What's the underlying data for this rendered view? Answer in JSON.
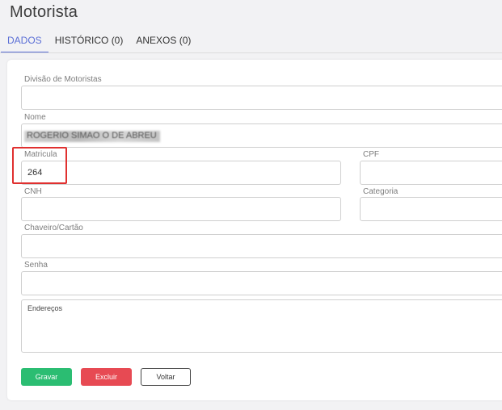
{
  "page": {
    "title": "Motorista"
  },
  "tabs": [
    {
      "label": "DADOS",
      "active": true
    },
    {
      "label": "HISTÓRICO (0)",
      "active": false
    },
    {
      "label": "ANEXOS (0)",
      "active": false
    }
  ],
  "form": {
    "divisao": {
      "label": "Divisão de Motoristas",
      "value": ""
    },
    "nome": {
      "label": "Nome",
      "value": "ROGERIO SIMAO O DE ABREU"
    },
    "matricula": {
      "label": "Matricula",
      "value": "264"
    },
    "cpf": {
      "label": "CPF",
      "value": ""
    },
    "cnh": {
      "label": "CNH",
      "value": ""
    },
    "categoria": {
      "label": "Categoria",
      "value": ""
    },
    "chaveiro": {
      "label": "Chaveiro/Cartão",
      "value": ""
    },
    "senha": {
      "label": "Senha",
      "value": ""
    },
    "enderecos": {
      "placeholder": "Endereços"
    }
  },
  "buttons": {
    "save": "Gravar",
    "delete": "Excluir",
    "back": "Voltar"
  },
  "colors": {
    "accent": "#5b6fd6",
    "save": "#2bbd72",
    "delete": "#e74a53",
    "highlight": "#e0302f"
  }
}
